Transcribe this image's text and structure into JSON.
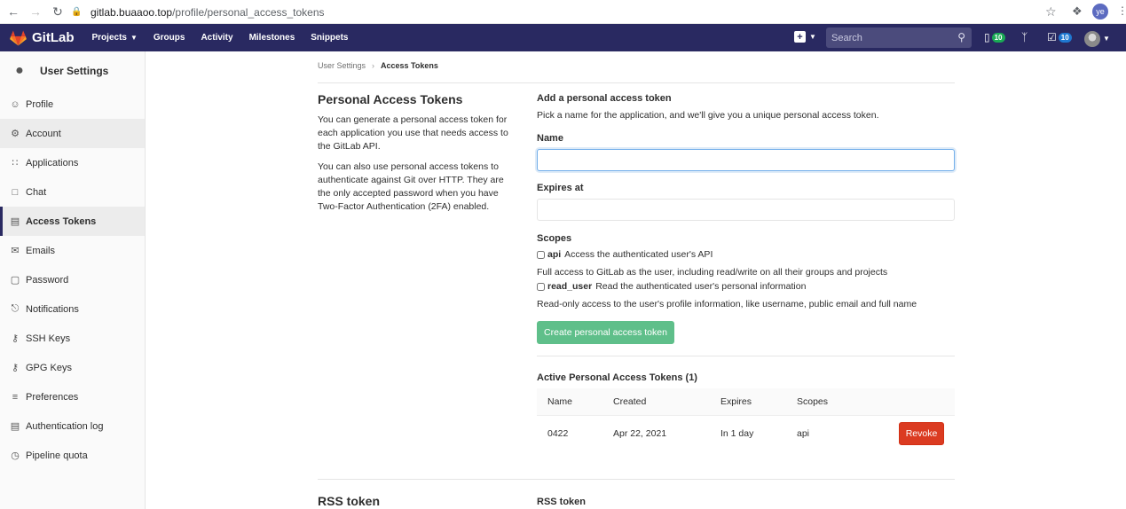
{
  "browser": {
    "url_host": "gitlab.buaaoo.top",
    "url_path": "/profile/personal_access_tokens",
    "profile_initials": "ye"
  },
  "header": {
    "brand": "GitLab",
    "nav": [
      "Projects",
      "Groups",
      "Activity",
      "Milestones",
      "Snippets"
    ],
    "search_placeholder": "Search",
    "issues_count": "10",
    "todos_count": "10"
  },
  "sidebar": {
    "title": "User Settings",
    "items": [
      {
        "label": "Profile",
        "icon": "profile-icon"
      },
      {
        "label": "Account",
        "icon": "account-icon"
      },
      {
        "label": "Applications",
        "icon": "applications-icon"
      },
      {
        "label": "Chat",
        "icon": "chat-icon"
      },
      {
        "label": "Access Tokens",
        "icon": "token-icon"
      },
      {
        "label": "Emails",
        "icon": "email-icon"
      },
      {
        "label": "Password",
        "icon": "lock-icon"
      },
      {
        "label": "Notifications",
        "icon": "bell-icon"
      },
      {
        "label": "SSH Keys",
        "icon": "key-icon"
      },
      {
        "label": "GPG Keys",
        "icon": "key-icon"
      },
      {
        "label": "Preferences",
        "icon": "preferences-icon"
      },
      {
        "label": "Authentication log",
        "icon": "log-icon"
      },
      {
        "label": "Pipeline quota",
        "icon": "quota-icon"
      }
    ]
  },
  "breadcrumb": {
    "parent": "User Settings",
    "current": "Access Tokens"
  },
  "pat": {
    "title": "Personal Access Tokens",
    "para1": "You can generate a personal access token for each application you use that needs access to the GitLab API.",
    "para2": "You can also use personal access tokens to authenticate against Git over HTTP. They are the only accepted password when you have Two-Factor Authentication (2FA) enabled.",
    "form_title": "Add a personal access token",
    "form_sub": "Pick a name for the application, and we'll give you a unique personal access token.",
    "name_label": "Name",
    "name_value": "",
    "expires_label": "Expires at",
    "expires_value": "",
    "scopes_label": "Scopes",
    "scopes": [
      {
        "key": "api",
        "summary": "Access the authenticated user's API",
        "desc": "Full access to GitLab as the user, including read/write on all their groups and projects",
        "checked": false
      },
      {
        "key": "read_user",
        "summary": "Read the authenticated user's personal information",
        "desc": "Read-only access to the user's profile information, like username, public email and full name",
        "checked": false
      }
    ],
    "create_button": "Create personal access token"
  },
  "active_tokens": {
    "title": "Active Personal Access Tokens (1)",
    "columns": [
      "Name",
      "Created",
      "Expires",
      "Scopes"
    ],
    "rows": [
      {
        "name": "0422",
        "created": "Apr 22, 2021",
        "expires": "In 1 day",
        "scopes": "api",
        "action": "Revoke"
      }
    ]
  },
  "rss": {
    "title": "RSS token",
    "sub_title": "RSS token"
  },
  "colors": {
    "header_bg": "#292961",
    "create_button": "#5fbf8a",
    "revoke_button": "#db3b21",
    "expires_warning": "#fc9403"
  }
}
